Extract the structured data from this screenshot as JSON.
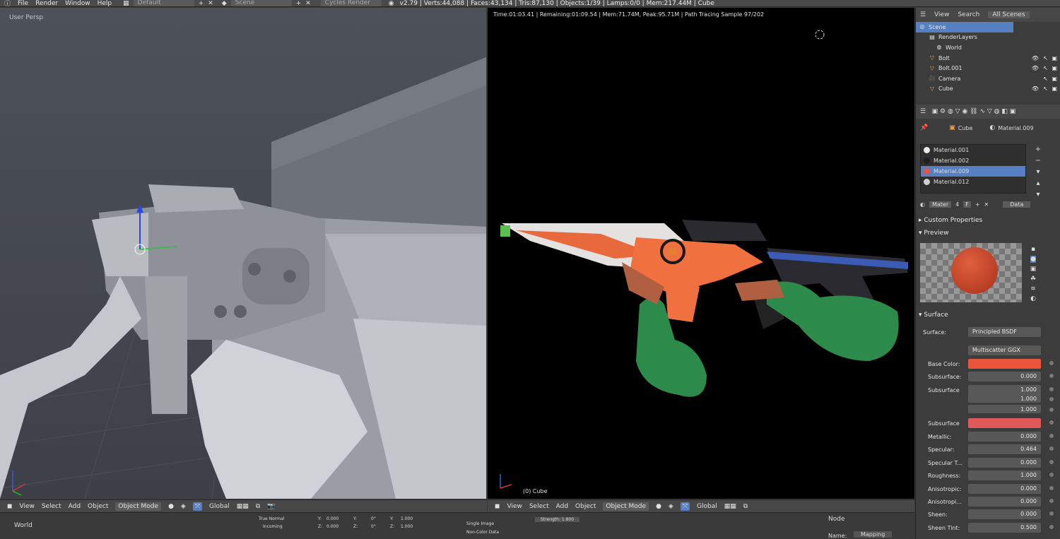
{
  "topbar": {
    "menus": [
      "File",
      "Render",
      "Window",
      "Help"
    ],
    "layout": "Default",
    "scene": "Scene",
    "engine": "Cycles Render",
    "stats": "v2.79 | Verts:44,088 | Faces:43,134 | Tris:87,130 | Objects:1/39 | Lamps:0/0 | Mem:217.44M | Cube"
  },
  "viewport_left": {
    "label": "User Persp"
  },
  "viewport_right": {
    "status": "Time:01:03.41 | Remaining:01:09.54 | Mem:71.74M, Peak:95.71M | Path Tracing Sample 97/202",
    "object": "(0) Cube"
  },
  "header_left": {
    "items": [
      "View",
      "Select",
      "Add",
      "Object"
    ],
    "mode": "Object Mode",
    "orientation": "Global"
  },
  "header_right": {
    "items": [
      "View",
      "Select",
      "Add",
      "Object"
    ],
    "mode": "Object Mode",
    "orientation": "Global"
  },
  "bottom": {
    "world": "World",
    "node_items": [
      "True Normal",
      "Incoming"
    ],
    "image": "Single Image",
    "colordata": "Non-Color Data",
    "strength": "Strength: 1.800",
    "coords": {
      "y1": "Y:",
      "x1v": "0.000",
      "z1": "Z:",
      "z1v": "0.000",
      "y2": "Y:",
      "y2v": "0°",
      "z2": "Z:",
      "z2v": "0°",
      "x3": "Y:",
      "x3v": "1.000",
      "z3": "Z:",
      "z3v": "1.000"
    },
    "node_panel": "Node",
    "name_label": "Name:",
    "name_value": "Mapping"
  },
  "outliner": {
    "tabs": [
      "View",
      "Search",
      "All Scenes"
    ],
    "rows": [
      {
        "name": "Scene",
        "sel": true
      },
      {
        "name": "RenderLayers"
      },
      {
        "name": "World"
      },
      {
        "name": "Bolt"
      },
      {
        "name": "Bolt.001"
      },
      {
        "name": "Camera"
      },
      {
        "name": "Cube"
      }
    ]
  },
  "props": {
    "context_object": "Cube",
    "context_material": "Material.009",
    "materials": [
      {
        "name": "Material.001",
        "color": "#e8e8e8"
      },
      {
        "name": "Material.002",
        "color": "#202020"
      },
      {
        "name": "Material.009",
        "color": "#e8553a",
        "sel": true
      },
      {
        "name": "Material.012",
        "color": "#d0d0d0"
      }
    ],
    "mat_field": "Mater",
    "mat_users": "4",
    "mat_f": "F",
    "data_select": "Data",
    "custom_props": "Custom Properties",
    "preview": "Preview",
    "surface_section": "Surface",
    "surface_label": "Surface:",
    "surface_value": "Principled BSDF",
    "distribution": "Multiscatter GGX",
    "rows": [
      {
        "label": "Base Color:",
        "value": "",
        "color": "#e8553a"
      },
      {
        "label": "Subsurface:",
        "value": "0.000"
      },
      {
        "label": "Subsurface",
        "value": "1.000"
      },
      {
        "label": "",
        "value": "1.000"
      },
      {
        "label": "",
        "value": "1.000"
      },
      {
        "label": "Subsurface",
        "value": "",
        "color": "#e05a5a"
      },
      {
        "label": "Metallic:",
        "value": "0.000"
      },
      {
        "label": "Specular:",
        "value": "0.464"
      },
      {
        "label": "Specular T...",
        "value": "0.000"
      },
      {
        "label": "Roughness:",
        "value": "1.000"
      },
      {
        "label": "Anisotropic:",
        "value": "0.000"
      },
      {
        "label": "Anisotropi...",
        "value": "0.000"
      },
      {
        "label": "Sheen:",
        "value": "0.000"
      },
      {
        "label": "Sheen Tint:",
        "value": "0.500"
      }
    ]
  }
}
